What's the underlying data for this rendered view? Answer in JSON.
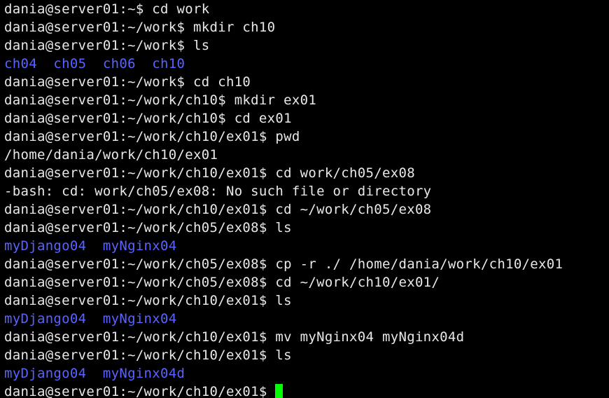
{
  "terminal": {
    "colors": {
      "background": "#000000",
      "text": "#e8e8e8",
      "directory": "#5a63ff",
      "cursor": "#00ff00"
    },
    "lines": [
      {
        "type": "prompt",
        "text": "dania@server01:~$ cd work"
      },
      {
        "type": "prompt",
        "text": "dania@server01:~/work$ mkdir ch10"
      },
      {
        "type": "prompt",
        "text": "dania@server01:~/work$ ls"
      },
      {
        "type": "dirs",
        "text": "ch04  ch05  ch06  ch10"
      },
      {
        "type": "prompt",
        "text": "dania@server01:~/work$ cd ch10"
      },
      {
        "type": "prompt",
        "text": "dania@server01:~/work/ch10$ mkdir ex01"
      },
      {
        "type": "prompt",
        "text": "dania@server01:~/work/ch10$ cd ex01"
      },
      {
        "type": "prompt",
        "text": "dania@server01:~/work/ch10/ex01$ pwd"
      },
      {
        "type": "output",
        "text": "/home/dania/work/ch10/ex01"
      },
      {
        "type": "prompt",
        "text": "dania@server01:~/work/ch10/ex01$ cd work/ch05/ex08"
      },
      {
        "type": "output",
        "text": "-bash: cd: work/ch05/ex08: No such file or directory"
      },
      {
        "type": "prompt",
        "text": "dania@server01:~/work/ch10/ex01$ cd ~/work/ch05/ex08"
      },
      {
        "type": "prompt",
        "text": "dania@server01:~/work/ch05/ex08$ ls"
      },
      {
        "type": "dirs",
        "text": "myDjango04  myNginx04"
      },
      {
        "type": "prompt",
        "text": "dania@server01:~/work/ch05/ex08$ cp -r ./ /home/dania/work/ch10/ex01"
      },
      {
        "type": "prompt",
        "text": "dania@server01:~/work/ch05/ex08$ cd ~/work/ch10/ex01/"
      },
      {
        "type": "prompt",
        "text": "dania@server01:~/work/ch10/ex01$ ls"
      },
      {
        "type": "dirs",
        "text": "myDjango04  myNginx04"
      },
      {
        "type": "prompt",
        "text": "dania@server01:~/work/ch10/ex01$ mv myNginx04 myNginx04d"
      },
      {
        "type": "prompt",
        "text": "dania@server01:~/work/ch10/ex01$ ls"
      },
      {
        "type": "dirs",
        "text": "myDjango04  myNginx04d"
      }
    ],
    "current_prompt": "dania@server01:~/work/ch10/ex01$ "
  }
}
